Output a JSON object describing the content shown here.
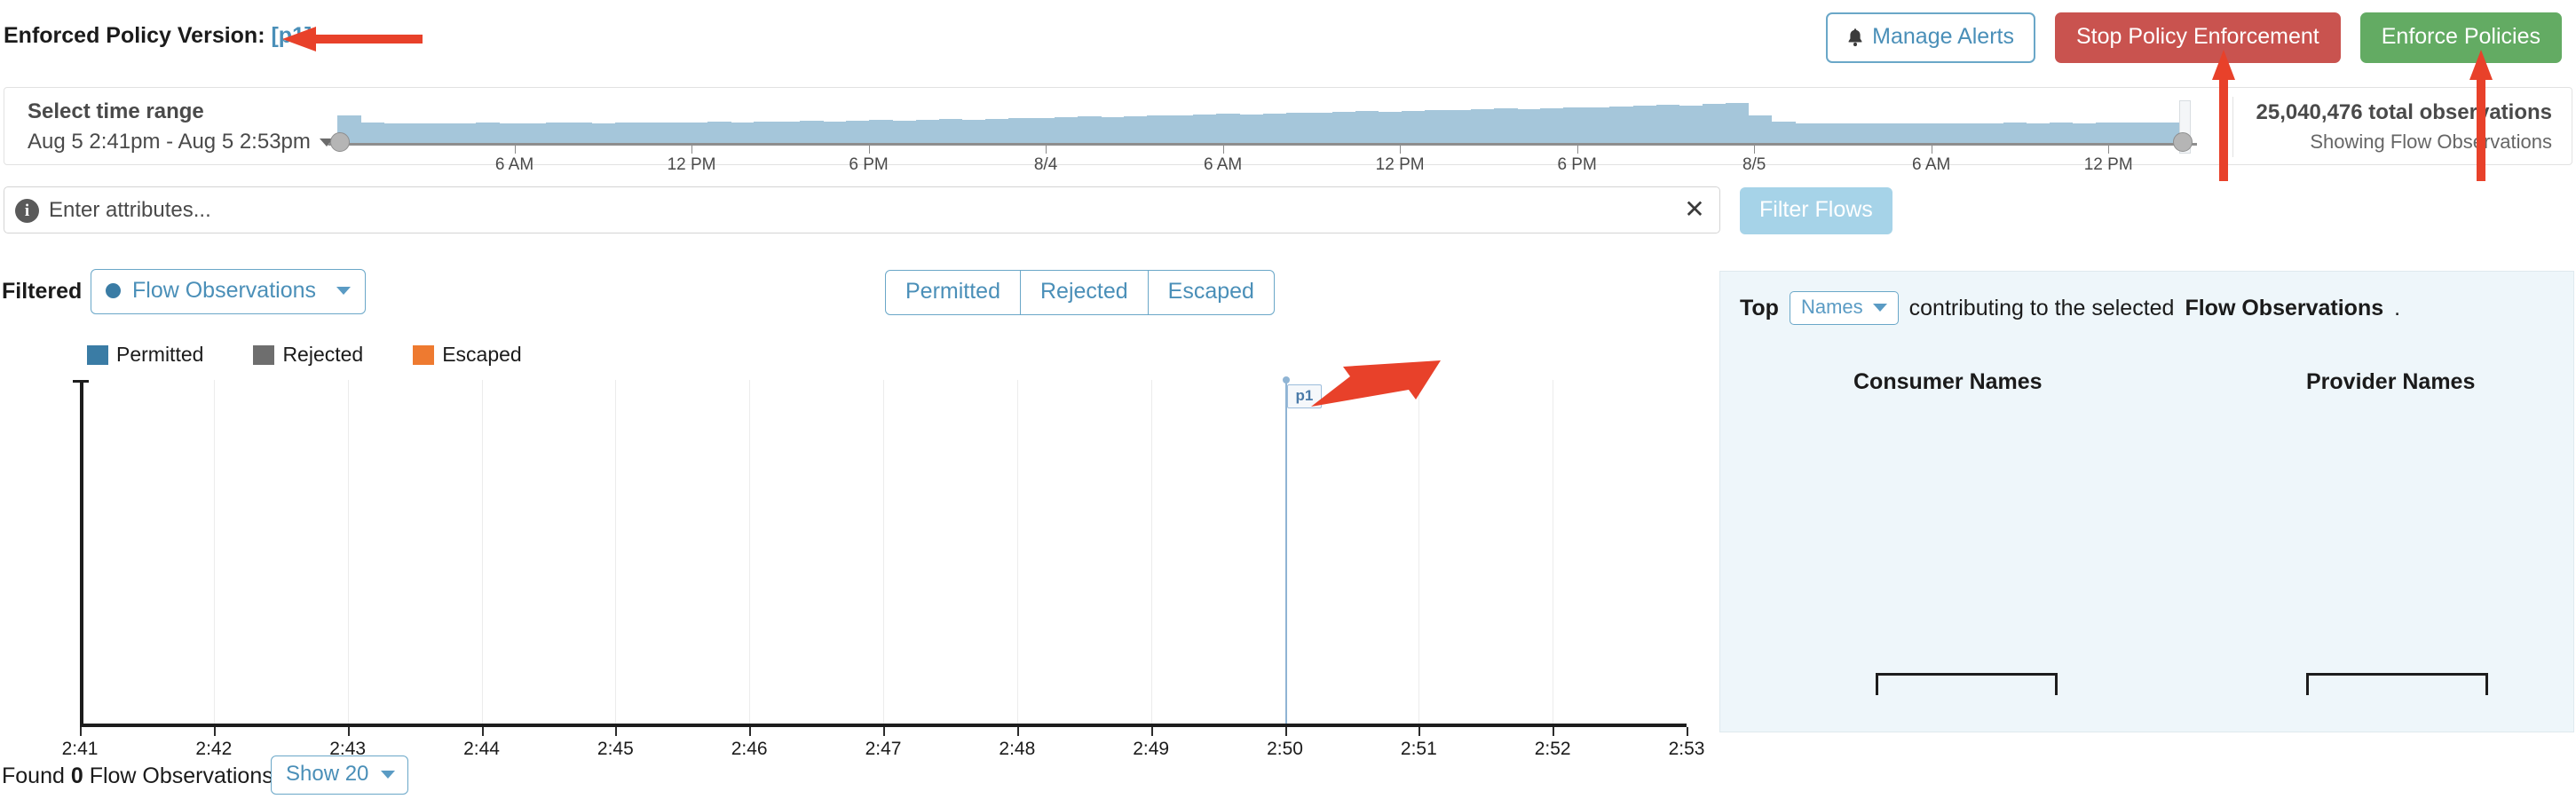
{
  "header": {
    "policy_label": "Enforced Policy Version:",
    "policy_version": "[p1]",
    "buttons": {
      "manage_alerts": "Manage Alerts",
      "stop_policy_enforcement": "Stop Policy Enforcement",
      "enforce_policies": "Enforce Policies"
    },
    "colors": {
      "danger": "#c9534f",
      "success": "#63ab63",
      "link": "#4a8fb8",
      "annotation_arrow": "#e8412a"
    }
  },
  "time_range": {
    "label": "Select time range",
    "value": "Aug 5 2:41pm - Aug 5 2:53pm",
    "caret_icon": "chevron-down-icon",
    "ticks": [
      "6 AM",
      "12 PM",
      "6 PM",
      "8/4",
      "6 AM",
      "12 PM",
      "6 PM",
      "8/5",
      "6 AM",
      "12 PM"
    ],
    "total_observations": "25,040,476 total observations",
    "showing": "Showing Flow Observations"
  },
  "attributes": {
    "info_icon": "info-icon",
    "placeholder": "Enter attributes...",
    "value": "",
    "clear_icon": "close-icon",
    "filter_button": "Filter Flows"
  },
  "controls": {
    "filtered_label": "Filtered",
    "flow_dropdown": "Flow Observations",
    "segments": [
      "Permitted",
      "Rejected",
      "Escaped"
    ]
  },
  "legend": [
    {
      "label": "Permitted",
      "color": "#3a7ca5"
    },
    {
      "label": "Rejected",
      "color": "#6e6e6e"
    },
    {
      "label": "Escaped",
      "color": "#ee7a30"
    }
  ],
  "right_panel": {
    "top_label": "Top",
    "names_dropdown": "Names",
    "tail_text_1": "contributing to the selected",
    "tail_bold": "Flow Observations",
    "tail_text_2": ".",
    "columns": [
      "Consumer Names",
      "Provider Names"
    ]
  },
  "footer": {
    "found_prefix": "Found",
    "found_count": "0",
    "found_suffix": "Flow Observations",
    "show_dropdown": "Show 20"
  },
  "chart_data": {
    "type": "bar",
    "title": "",
    "xlabel": "",
    "ylabel": "",
    "categories": [
      "2:41",
      "2:42",
      "2:43",
      "2:44",
      "2:45",
      "2:46",
      "2:47",
      "2:48",
      "2:49",
      "2:50",
      "2:51",
      "2:52",
      "2:53"
    ],
    "series": [
      {
        "name": "Permitted",
        "color": "#3a7ca5",
        "values": [
          0,
          0,
          0,
          0,
          0,
          0,
          0,
          0,
          0,
          0,
          0,
          0,
          0
        ]
      },
      {
        "name": "Rejected",
        "color": "#6e6e6e",
        "values": [
          0,
          0,
          0,
          0,
          0,
          0,
          0,
          0,
          0,
          0,
          0,
          0,
          0
        ]
      },
      {
        "name": "Escaped",
        "color": "#ee7a30",
        "values": [
          0,
          0,
          0,
          0,
          0,
          0,
          0,
          0,
          0,
          0,
          0,
          0,
          0
        ]
      }
    ],
    "ylim": [
      0,
      1
    ],
    "grid": true,
    "legend_position": "top-left",
    "annotations": [
      {
        "label": "p1",
        "x": "2:50",
        "type": "policy-version-marker",
        "color": "#8fb4d4"
      }
    ]
  },
  "timeline_data": {
    "type": "area",
    "note": "observation volume sparkline over selected window",
    "values": [
      0.62,
      0.46,
      0.44,
      0.45,
      0.45,
      0.45,
      0.46,
      0.45,
      0.45,
      0.46,
      0.46,
      0.45,
      0.46,
      0.47,
      0.46,
      0.47,
      0.48,
      0.47,
      0.48,
      0.49,
      0.5,
      0.49,
      0.5,
      0.52,
      0.51,
      0.53,
      0.54,
      0.53,
      0.55,
      0.57,
      0.56,
      0.58,
      0.6,
      0.59,
      0.61,
      0.63,
      0.62,
      0.64,
      0.66,
      0.65,
      0.67,
      0.69,
      0.68,
      0.7,
      0.72,
      0.71,
      0.73,
      0.75,
      0.74,
      0.76,
      0.78,
      0.77,
      0.79,
      0.81,
      0.8,
      0.82,
      0.84,
      0.86,
      0.85,
      0.88,
      0.9,
      0.62,
      0.48,
      0.44,
      0.44,
      0.45,
      0.44,
      0.45,
      0.44,
      0.45,
      0.44,
      0.45,
      0.46,
      0.45,
      0.46,
      0.45,
      0.46,
      0.47,
      0.46,
      0.47
    ]
  },
  "annotations": [
    {
      "name": "arrow-policy-version",
      "points_at": "policy-version-link"
    },
    {
      "name": "arrow-stop-policy",
      "points_at": "stop-policy-enforcement-button"
    },
    {
      "name": "arrow-enforce-policies",
      "points_at": "enforce-policies-button"
    },
    {
      "name": "arrow-chart-marker",
      "points_at": "chart-policy-marker-p1"
    }
  ]
}
